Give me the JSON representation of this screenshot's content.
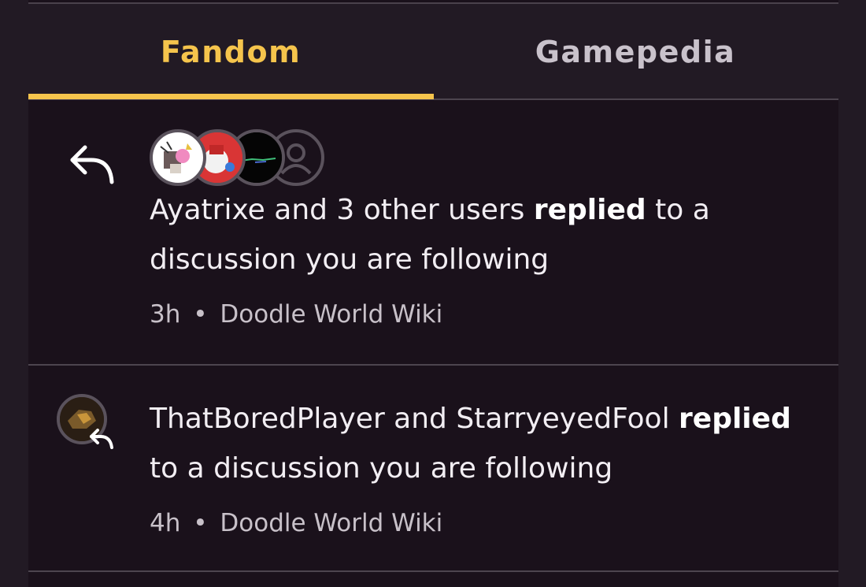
{
  "tabs": [
    {
      "label": "Fandom",
      "active": true
    },
    {
      "label": "Gamepedia",
      "active": false
    }
  ],
  "notifications": [
    {
      "icon": "reply-arrow-icon",
      "text_before": "Ayatrixe and 3 other users ",
      "text_bold": "replied",
      "text_after": " to a discussion you are following",
      "time": "3h",
      "separator": "•",
      "wiki": "Doodle World Wiki",
      "avatars": [
        "user-avatar-1",
        "user-avatar-2",
        "user-avatar-3",
        "default-user-icon"
      ]
    },
    {
      "icon": "reply-arrow-icon",
      "text_before": "ThatBoredPlayer and StarryeyedFool ",
      "text_bold": "replied",
      "text_after": " to a discussion you are following",
      "time": "4h",
      "separator": "•",
      "wiki": "Doodle World Wiki",
      "avatars": [
        "user-avatar"
      ]
    }
  ],
  "colors": {
    "accent": "#f5c44c",
    "background": "#1a111b",
    "header": "#221a24"
  }
}
